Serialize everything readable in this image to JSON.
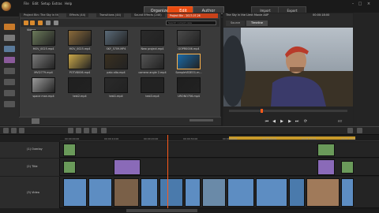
{
  "menu": [
    "File",
    "Edit",
    "Setup",
    "Extras",
    "Help"
  ],
  "modes": {
    "organize": "Organize",
    "edit": "Edit",
    "author": "Author"
  },
  "right_modes": {
    "import": "Import",
    "export": "Export"
  },
  "library": {
    "tabs": [
      "Project Bin: The Sky in the Limit...",
      "Effects (44)",
      "Transitions (44)",
      "Sound Effects (240)"
    ],
    "project_bin": "Project Bin - 2017-07-26",
    "search_placeholder": "Search current view",
    "breadcrumb": "Videos",
    "items": [
      {
        "label": "MOV_0025.mp4",
        "color": "#6b7a5a"
      },
      {
        "label": "MOV_0025.mp4",
        "color": "#8a6a3a"
      },
      {
        "label": "SKY_5709.MP4",
        "color": "#5a6a78"
      },
      {
        "label": "New project.mp4",
        "color": "#2a2a2a"
      },
      {
        "label": "GOPR0006.mp4",
        "color": "#4a4a4a"
      },
      {
        "label": "MVI2779.mp4",
        "color": "#7a7a7a"
      },
      {
        "label": "POTV8006.mp4",
        "color": "#caa84a"
      },
      {
        "label": "palo alto.mp4",
        "color": "#3a3020"
      },
      {
        "label": "camera angle 2.mp4",
        "color": "#555555"
      },
      {
        "label": "SampleVIDEO1.m...",
        "color": "#1a6aa8"
      },
      {
        "label": "space man.mp4",
        "color": "#9a9a9a"
      },
      {
        "label": "test2.mp4",
        "color": "#1f1f1f"
      },
      {
        "label": "test1.mp4",
        "color": "#2a2a2a"
      },
      {
        "label": "test3.mp4",
        "color": "#222222"
      },
      {
        "label": "URONO756.mp4",
        "color": "#1e1e1e"
      }
    ]
  },
  "player": {
    "title": "The Sky in the Limit Movie AXP",
    "timecode": "00:00:18:00",
    "tabs": [
      "Source",
      "Timeline"
    ],
    "active_tab": "Timeline",
    "zoom": "FIT"
  },
  "timeline": {
    "tracks": [
      {
        "name": "(1) Overlay"
      },
      {
        "name": "(2) Title"
      },
      {
        "name": "(3) Video"
      }
    ],
    "ruler_labels": [
      "00:00:00:00",
      "00:00:10:00",
      "00:00:20:00",
      "00:00:30:00",
      "00:00:40:00",
      "00:00:50:00",
      "00:01:00:00",
      "00:01:10:00"
    ]
  },
  "colors": {
    "accent": "#e94a10",
    "bg": "#1e1e1e",
    "clip_blue": "#5d8dc2",
    "clip_purple": "#8a6ab8",
    "clip_green": "#6a9a5a"
  }
}
